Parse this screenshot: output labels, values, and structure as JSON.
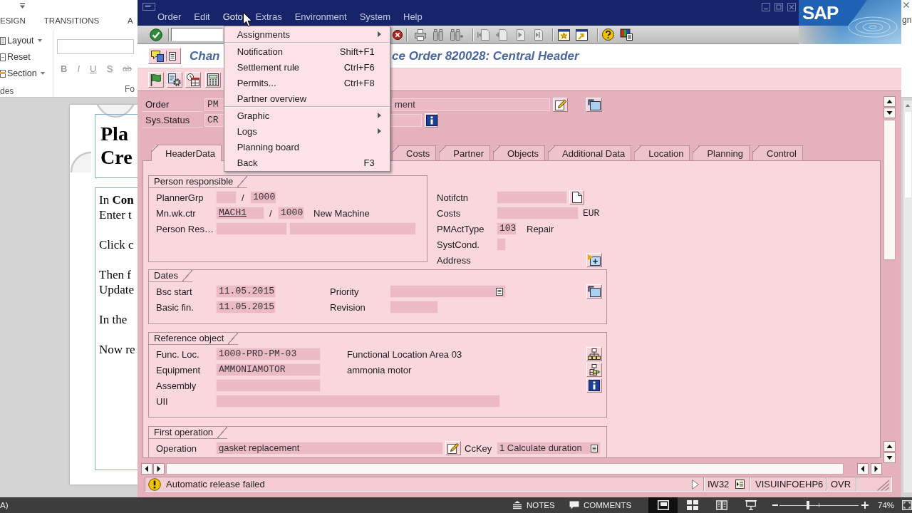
{
  "powerpoint": {
    "ribbon_tabs": [
      "ESIGN",
      "TRANSITIONS",
      "A"
    ],
    "slides_group": {
      "buttons": [
        {
          "label": "Layout",
          "dropdown": true
        },
        {
          "label": "Reset",
          "dropdown": false
        },
        {
          "label": "Section",
          "dropdown": true
        }
      ],
      "caption": "des"
    },
    "font_group": {
      "format_buttons": [
        "B",
        "I",
        "U",
        "S",
        "ab"
      ],
      "caption": "Fo"
    },
    "slide": {
      "title_lines": [
        "Pla",
        "Cre"
      ],
      "paragraphs": [
        {
          "lines": [
            "In **Con**",
            "Enter t"
          ]
        },
        {
          "lines": [
            "Click c"
          ]
        },
        {
          "lines": [
            "Then f",
            "Update"
          ]
        },
        {
          "lines": [
            "In the"
          ]
        },
        {
          "lines": [
            "Now re"
          ]
        }
      ]
    },
    "account_text": "gn",
    "status_bar": {
      "left_text": "A)",
      "notes": "NOTES",
      "comments": "COMMENTS",
      "views": [
        {
          "selected": true
        },
        {
          "selected": false
        },
        {
          "selected": false
        },
        {
          "selected": false
        }
      ],
      "zoom": {
        "level": 0.36
      },
      "zoom_reading": "74%"
    }
  },
  "sap": {
    "menu_bar": [
      {
        "label": "Order",
        "open": false
      },
      {
        "label": "Edit",
        "open": false
      },
      {
        "label": "Goto",
        "open": true
      },
      {
        "label": "Extras",
        "open": false
      },
      {
        "label": "Environment",
        "open": false
      },
      {
        "label": "System",
        "open": false
      },
      {
        "label": "Help",
        "open": false
      }
    ],
    "dropdown_menu": {
      "sections": [
        {
          "items": [
            {
              "label": "Assignments",
              "submenu": true
            }
          ]
        },
        {
          "items": [
            {
              "label": "Notification",
              "shortcut": "Shift+F1",
              "submenu": false
            },
            {
              "label": "Settlement rule",
              "shortcut": "Ctrl+F6",
              "submenu": false
            },
            {
              "label": "Permits...",
              "shortcut": "Ctrl+F8",
              "submenu": false
            },
            {
              "label": "Partner overview",
              "submenu": false
            }
          ]
        },
        {
          "items": [
            {
              "label": "Graphic",
              "submenu": true
            },
            {
              "label": "Logs",
              "submenu": true
            },
            {
              "label": "Planning board",
              "submenu": false
            },
            {
              "label": "Back",
              "shortcut": "F3",
              "submenu": false
            }
          ]
        }
      ]
    },
    "logo": "SAP",
    "title_parts": [
      "Chan",
      "ce Order 820028: Central Header"
    ],
    "header": [
      {
        "label": "Order",
        "fields": [
          {
            "value": "PM"
          },
          {
            "value": "ment"
          }
        ]
      },
      {
        "label": "Sys.Status",
        "fields": [
          {
            "value": "CR"
          }
        ]
      }
    ],
    "tabs": [
      {
        "label": "HeaderData",
        "selected": true
      },
      {
        "label": "Costs",
        "selected": false
      },
      {
        "label": "Partner",
        "selected": false
      },
      {
        "label": "Objects",
        "selected": false
      },
      {
        "label": "Additional Data",
        "selected": false
      },
      {
        "label": "Location",
        "selected": false
      },
      {
        "label": "Planning",
        "selected": false
      },
      {
        "label": "Control",
        "selected": false
      }
    ],
    "person_responsible": {
      "title": "Person responsible",
      "rows": [
        {
          "label": "PlannerGrp",
          "parts": [
            {
              "kind": "field"
            },
            {
              "kind": "text",
              "text": "/"
            },
            {
              "kind": "field",
              "value": "1000"
            }
          ]
        },
        {
          "label": "Mn.wk.ctr",
          "parts": [
            {
              "kind": "field",
              "value": "MACH1",
              "link": true
            },
            {
              "kind": "text",
              "text": "/"
            },
            {
              "kind": "field",
              "value": "1000",
              "link": false
            },
            {
              "kind": "text",
              "text": "New Machine"
            }
          ]
        },
        {
          "label": "Person Res…",
          "parts": [
            {
              "kind": "field"
            },
            {
              "kind": "field"
            }
          ]
        }
      ]
    },
    "details": {
      "rows": [
        {
          "label": "Notifctn",
          "parts": [
            {
              "kind": "field"
            }
          ]
        },
        {
          "label": "Costs",
          "parts": [
            {
              "kind": "field"
            },
            {
              "kind": "text",
              "text": "EUR"
            }
          ]
        },
        {
          "label": "PMActType",
          "parts": [
            {
              "kind": "field",
              "value": "103"
            },
            {
              "kind": "text",
              "text": "Repair"
            }
          ]
        },
        {
          "label": "SystCond.",
          "parts": [
            {
              "kind": "field"
            }
          ]
        },
        {
          "label": "Address"
        }
      ]
    },
    "dates": {
      "title": "Dates",
      "rows": [
        {
          "label": "Bsc start",
          "parts": [
            {
              "kind": "field",
              "value": "11.05.2015"
            },
            {
              "kind": "label",
              "text": "Priority"
            },
            {
              "kind": "dropdown"
            }
          ]
        },
        {
          "label": "Basic fin.",
          "parts": [
            {
              "kind": "field",
              "value": "11.05.2015"
            },
            {
              "kind": "label",
              "text": "Revision"
            },
            {
              "kind": "field"
            }
          ]
        }
      ]
    },
    "reference_object": {
      "title": "Reference object",
      "rows": [
        {
          "label": "Func. Loc.",
          "parts": [
            {
              "kind": "field",
              "value": "1000-PRD-PM-03"
            },
            {
              "kind": "text",
              "text": "Functional Location Area 03"
            }
          ]
        },
        {
          "label": "Equipment",
          "parts": [
            {
              "kind": "field",
              "value": "AMMONIAMOTOR"
            },
            {
              "kind": "text",
              "text": "ammonia motor"
            }
          ]
        },
        {
          "label": "Assembly",
          "parts": [
            {
              "kind": "field"
            }
          ]
        },
        {
          "label": "UII",
          "parts": [
            {
              "kind": "field"
            }
          ]
        }
      ]
    },
    "first_operation": {
      "title": "First operation",
      "rows": [
        {
          "label": "Operation",
          "parts": [
            {
              "kind": "field",
              "value": "gasket replacement"
            },
            {
              "kind": "label",
              "text": "CcKey"
            },
            {
              "kind": "dropdown",
              "value": "1 Calculate duration"
            }
          ]
        }
      ]
    },
    "status_bar": {
      "message": "Automatic release failed",
      "transaction": "IW32",
      "server": "VISUINFOEHP6",
      "mode": "OVR"
    }
  }
}
